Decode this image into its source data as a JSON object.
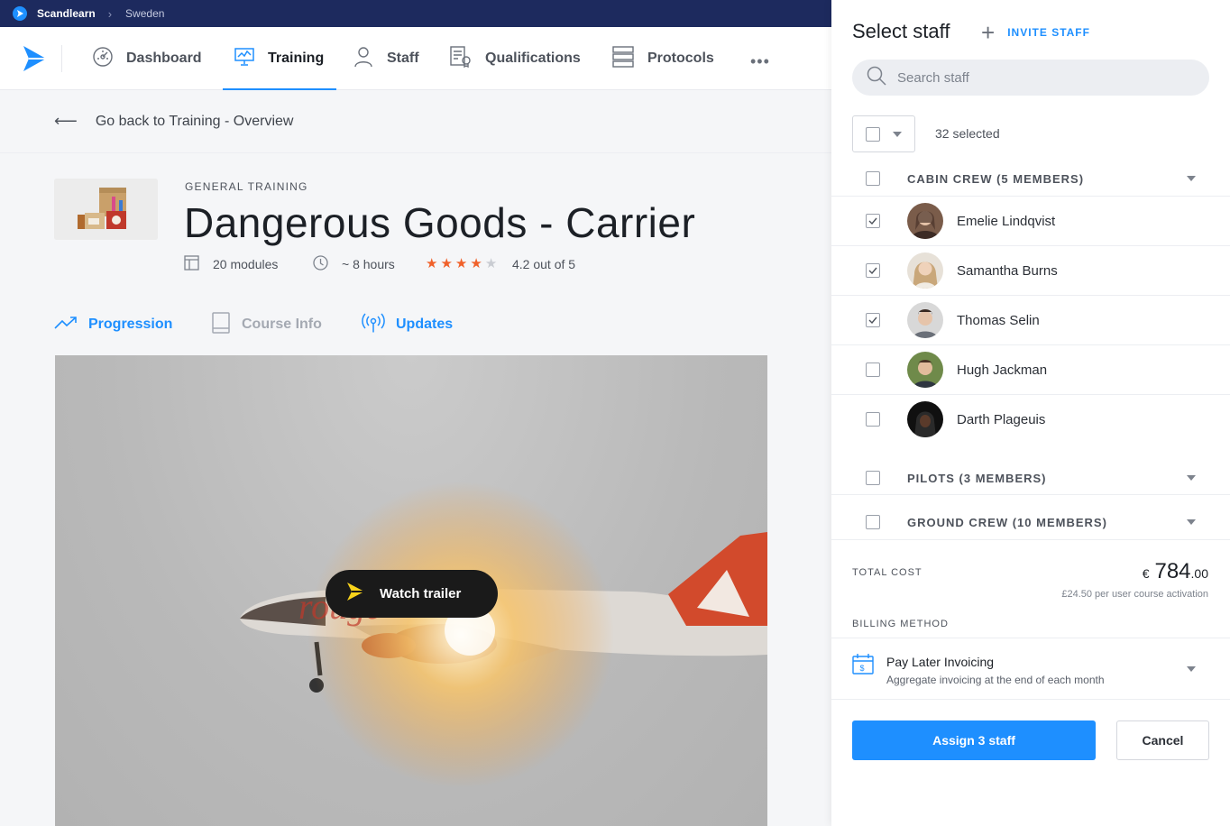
{
  "org_bar": {
    "brand": "Scandlearn",
    "breadcrumb": "Sweden"
  },
  "nav": {
    "items": [
      {
        "label": "Dashboard",
        "icon": "dashboard-icon"
      },
      {
        "label": "Training",
        "icon": "training-icon",
        "active": true
      },
      {
        "label": "Staff",
        "icon": "person-icon"
      },
      {
        "label": "Qualifications",
        "icon": "qualifications-icon"
      },
      {
        "label": "Protocols",
        "icon": "protocols-icon"
      }
    ],
    "more": "•••"
  },
  "back_link": {
    "arrow": "⟵",
    "label": "Go back to Training - Overview"
  },
  "course": {
    "category": "GENERAL TRAINING",
    "title": "Dangerous Goods - Carrier",
    "modules": "20 modules",
    "duration": "~ 8 hours",
    "rating_value": 4.2,
    "rating_stars": 4,
    "rating_text": "4.2 out of 5"
  },
  "tabs": [
    {
      "label": "Progression",
      "icon": "trend-icon"
    },
    {
      "label": "Course Info",
      "icon": "book-icon"
    },
    {
      "label": "Updates",
      "icon": "broadcast-icon"
    }
  ],
  "hero": {
    "trailer_label": "Watch trailer"
  },
  "panel": {
    "title": "Select staff",
    "invite_label": "INVITE STAFF",
    "search_placeholder": "Search staff",
    "selected_count": "32 selected",
    "groups": [
      {
        "label": "CABIN CREW (5 MEMBERS)",
        "members": [
          {
            "name": "Emelie Lindqvist",
            "checked": true
          },
          {
            "name": "Samantha Burns",
            "checked": true
          },
          {
            "name": "Thomas Selin",
            "checked": true
          },
          {
            "name": "Hugh Jackman",
            "checked": false
          },
          {
            "name": "Darth Plageuis",
            "checked": false
          }
        ]
      },
      {
        "label": "PILOTS (3 MEMBERS)"
      },
      {
        "label": "GROUND CREW (10 MEMBERS)"
      }
    ],
    "total_cost_label": "TOTAL COST",
    "currency": "€",
    "total_main": "784",
    "total_cents": ".00",
    "cost_note": "£24.50 per user course activation",
    "billing_label": "BILLING METHOD",
    "billing_title": "Pay Later Invoicing",
    "billing_sub": "Aggregate invoicing at the end of each month",
    "assign_label": "Assign 3 staff",
    "cancel_label": "Cancel"
  },
  "colors": {
    "accent": "#1e8fff",
    "org_bar": "#1d2a5e",
    "star": "#f0612a"
  }
}
